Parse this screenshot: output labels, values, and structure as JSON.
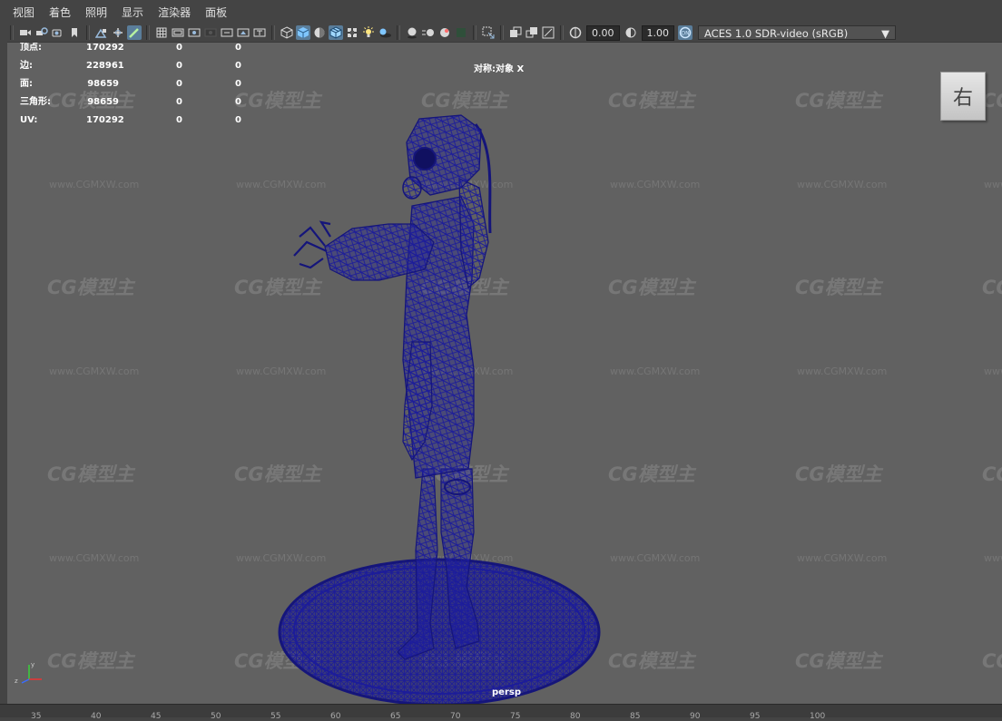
{
  "menubar": {
    "items": [
      "视图",
      "着色",
      "照明",
      "显示",
      "渲染器",
      "面板"
    ]
  },
  "toolbar": {
    "exposure_value": "0.00",
    "gamma_value": "1.00",
    "color_space": "ACES 1.0 SDR-video (sRGB)",
    "accent_color": "#5a7d9a",
    "icons": [
      "camera-select-icon",
      "camera-attributes-icon",
      "bookmark-icon",
      "image-plane-icon",
      "grid-icon",
      "film-gate-icon",
      "resolution-gate-icon",
      "gate-mask-icon",
      "field-chart-icon",
      "safe-action-icon",
      "safe-title-icon",
      "wireframe-icon",
      "smooth-shade-icon",
      "default-material-icon",
      "textured-icon",
      "use-all-lights-icon",
      "shadows-icon",
      "screen-space-ao-icon",
      "motion-blur-icon",
      "anti-aliasing-icon",
      "isolate-select-icon",
      "xray-icon",
      "xray-joints-icon",
      "backface-culling-icon",
      "exposure-icon",
      "gamma-icon",
      "color-management-icon"
    ]
  },
  "hud": {
    "rows": [
      {
        "label": "顶点:",
        "v1": "170292",
        "v2": "0",
        "v3": "0"
      },
      {
        "label": "边:",
        "v1": "228961",
        "v2": "0",
        "v3": "0"
      },
      {
        "label": "面:",
        "v1": "98659",
        "v2": "0",
        "v3": "0"
      },
      {
        "label": "三角形:",
        "v1": "98659",
        "v2": "0",
        "v3": "0"
      },
      {
        "label": "UV:",
        "v1": "170292",
        "v2": "0",
        "v3": "0"
      }
    ],
    "symmetry": "对称:对象 X",
    "camera": "persp"
  },
  "viewcube": {
    "face": "右"
  },
  "axis": {
    "x": "x",
    "y": "y",
    "z": "z"
  },
  "wireframe_color": "#1c1c9a",
  "viewport_bg": "#616161",
  "watermark": {
    "logo": "CG模型主",
    "url": "www.CGMXW.com"
  },
  "timeline": {
    "ticks": [
      "35",
      "40",
      "45",
      "50",
      "55",
      "60",
      "65",
      "70",
      "75",
      "80",
      "85",
      "90",
      "95",
      "100"
    ]
  }
}
